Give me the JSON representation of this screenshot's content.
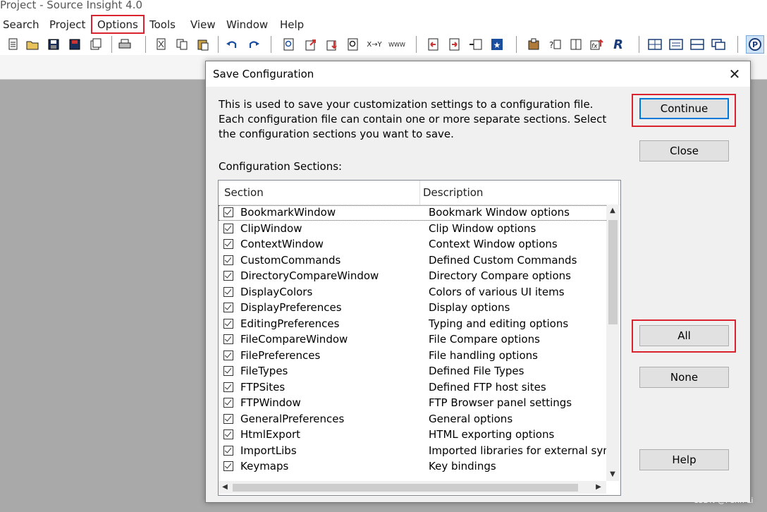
{
  "app": {
    "title": "Project - Source Insight 4.0"
  },
  "menubar": {
    "items": [
      {
        "label": "Search"
      },
      {
        "label": "Project"
      },
      {
        "label": "Options"
      },
      {
        "label": "Tools"
      },
      {
        "label": "View"
      },
      {
        "label": "Window"
      },
      {
        "label": "Help"
      }
    ]
  },
  "toolbar": {
    "icons": [
      "new-file-icon",
      "open-folder-icon",
      "save-icon",
      "save-all-icon",
      "close-files-icon",
      "print-icon",
      "cut-icon",
      "copy-icon",
      "paste-icon",
      "undo-icon",
      "redo-icon",
      "search-icon",
      "jump-icon",
      "bookmark-icon",
      "browse-icon",
      "replace-icon",
      "web-icon",
      "prev-icon",
      "next-icon",
      "relation-icon",
      "star-icon",
      "lookup-icon",
      "symbol-icon",
      "book-icon",
      "function-icon",
      "r-icon",
      "layout-icon",
      "panel-icon",
      "split-icon",
      "windows-icon",
      "p-icon"
    ],
    "x_y_label": "X→Y",
    "www_label": "WWW"
  },
  "dialog": {
    "title": "Save Configuration",
    "intro": "This is used to save your customization settings to a configuration file. Each configuration file can contain one or more separate sections. Select the configuration sections you want to save.",
    "sections_label": "Configuration Sections:",
    "columns": {
      "section": "Section",
      "description": "Description"
    },
    "rows": [
      {
        "section": "BookmarkWindow",
        "description": "Bookmark Window options",
        "checked": true
      },
      {
        "section": "ClipWindow",
        "description": "Clip Window options",
        "checked": true
      },
      {
        "section": "ContextWindow",
        "description": "Context Window options",
        "checked": true
      },
      {
        "section": "CustomCommands",
        "description": "Defined Custom Commands",
        "checked": true
      },
      {
        "section": "DirectoryCompareWindow",
        "description": "Directory Compare options",
        "checked": true
      },
      {
        "section": "DisplayColors",
        "description": "Colors of various UI items",
        "checked": true
      },
      {
        "section": "DisplayPreferences",
        "description": "Display options",
        "checked": true
      },
      {
        "section": "EditingPreferences",
        "description": "Typing and editing options",
        "checked": true
      },
      {
        "section": "FileCompareWindow",
        "description": "File Compare options",
        "checked": true
      },
      {
        "section": "FilePreferences",
        "description": "File handling options",
        "checked": true
      },
      {
        "section": "FileTypes",
        "description": "Defined File Types",
        "checked": true
      },
      {
        "section": "FTPSites",
        "description": "Defined FTP host sites",
        "checked": true
      },
      {
        "section": "FTPWindow",
        "description": "FTP Browser panel settings",
        "checked": true
      },
      {
        "section": "GeneralPreferences",
        "description": "General options",
        "checked": true
      },
      {
        "section": "HtmlExport",
        "description": "HTML exporting options",
        "checked": true
      },
      {
        "section": "ImportLibs",
        "description": "Imported libraries for external sym",
        "checked": true
      },
      {
        "section": "Keymaps",
        "description": "Key bindings",
        "checked": true
      }
    ],
    "buttons": {
      "continue": "Continue",
      "close": "Close",
      "all": "All",
      "none": "None",
      "help": "Help"
    }
  },
  "watermark": "CSDN @Penn Li",
  "colors": {
    "highlight": "#d9232e",
    "default_button_border": "#0078d7"
  }
}
